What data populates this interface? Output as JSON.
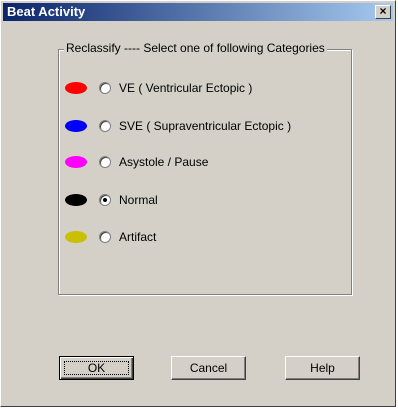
{
  "window": {
    "title": "Beat Activity",
    "close_glyph": "×"
  },
  "group": {
    "label": "Reclassify ---- Select one of following Categories",
    "options": [
      {
        "label": "VE ( Ventricular Ectopic )",
        "color": "#ff0000",
        "checked": false
      },
      {
        "label": "SVE ( Supraventricular Ectopic )",
        "color": "#0000ff",
        "checked": false
      },
      {
        "label": "Asystole / Pause",
        "color": "#ff00ff",
        "checked": false
      },
      {
        "label": "Normal",
        "color": "#000000",
        "checked": true
      },
      {
        "label": "Artifact",
        "color": "#c8c000",
        "checked": false
      }
    ]
  },
  "buttons": {
    "ok": "OK",
    "cancel": "Cancel",
    "help": "Help"
  }
}
